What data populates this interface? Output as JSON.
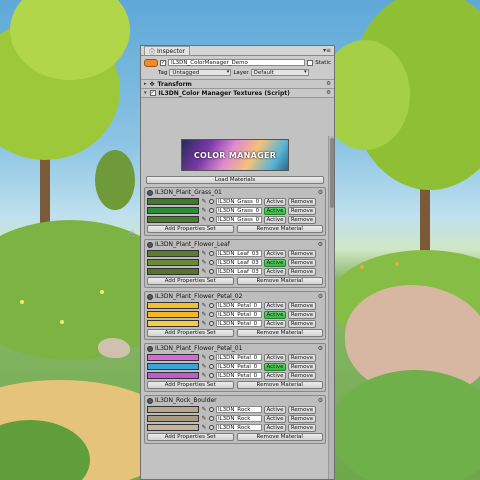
{
  "window": {
    "tab_label": "Inspector"
  },
  "object": {
    "name": "IL3DN_ColorManager_Demo",
    "static_label": "Static",
    "tag_label": "Tag",
    "tag_value": "Untagged",
    "layer_label": "Layer",
    "layer_value": "Default"
  },
  "components": {
    "transform": "Transform",
    "script": "IL3DN_Color Manager Textures (Script)"
  },
  "banner_text": "COLOR MANAGER",
  "load_materials_label": "Load Materials",
  "active_label": "Active",
  "remove_label": "Remove",
  "add_properties_label": "Add Properties Set",
  "remove_material_label": "Remove Material",
  "groups": [
    {
      "title": "IL3DN_Plant_Grass_01",
      "rows": [
        {
          "color": "#3f7a2a",
          "field": "IL3DN_Grass_0",
          "active": false
        },
        {
          "color": "#2e8b3a",
          "field": "IL3DN_Grass_0",
          "active": true
        },
        {
          "color": "#4a7d2c",
          "field": "IL3DN_Grass_0",
          "active": false
        }
      ]
    },
    {
      "title": "IL3DN_Plant_Flower_Leaf",
      "rows": [
        {
          "color": "#5e7a33",
          "field": "IL3DN_Leaf_03",
          "active": false
        },
        {
          "color": "#6a8a3a",
          "field": "IL3DN_Leaf_03",
          "active": true
        },
        {
          "color": "#55722e",
          "field": "IL3DN_Leaf_03",
          "active": false
        }
      ]
    },
    {
      "title": "IL3DN_Plant_Flower_Petal_02",
      "rows": [
        {
          "color": "#f4c030",
          "field": "IL3DN_Petal_0",
          "active": false
        },
        {
          "color": "#f6b81e",
          "field": "IL3DN_Petal_0",
          "active": true
        },
        {
          "color": "#f5cc45",
          "field": "IL3DN_Petal_0",
          "active": false
        }
      ]
    },
    {
      "title": "IL3DN_Plant_Flower_Petal_01",
      "rows": [
        {
          "color": "#d86ad8",
          "field": "IL3DN_Petal_0",
          "active": false
        },
        {
          "color": "#3aa4d8",
          "field": "IL3DN_Petal_0",
          "active": true
        },
        {
          "color": "#c05ad0",
          "field": "IL3DN_Petal_0",
          "active": false
        }
      ]
    },
    {
      "title": "IL3DN_Rock_Boulder",
      "rows": [
        {
          "color": "#b7a98e",
          "field": "IL3DN_Rock",
          "active": false
        },
        {
          "color": "#a89a80",
          "field": "IL3DN_Rock",
          "active": false
        },
        {
          "color": "#c4b599",
          "field": "IL3DN_Rock",
          "active": false
        }
      ]
    }
  ]
}
